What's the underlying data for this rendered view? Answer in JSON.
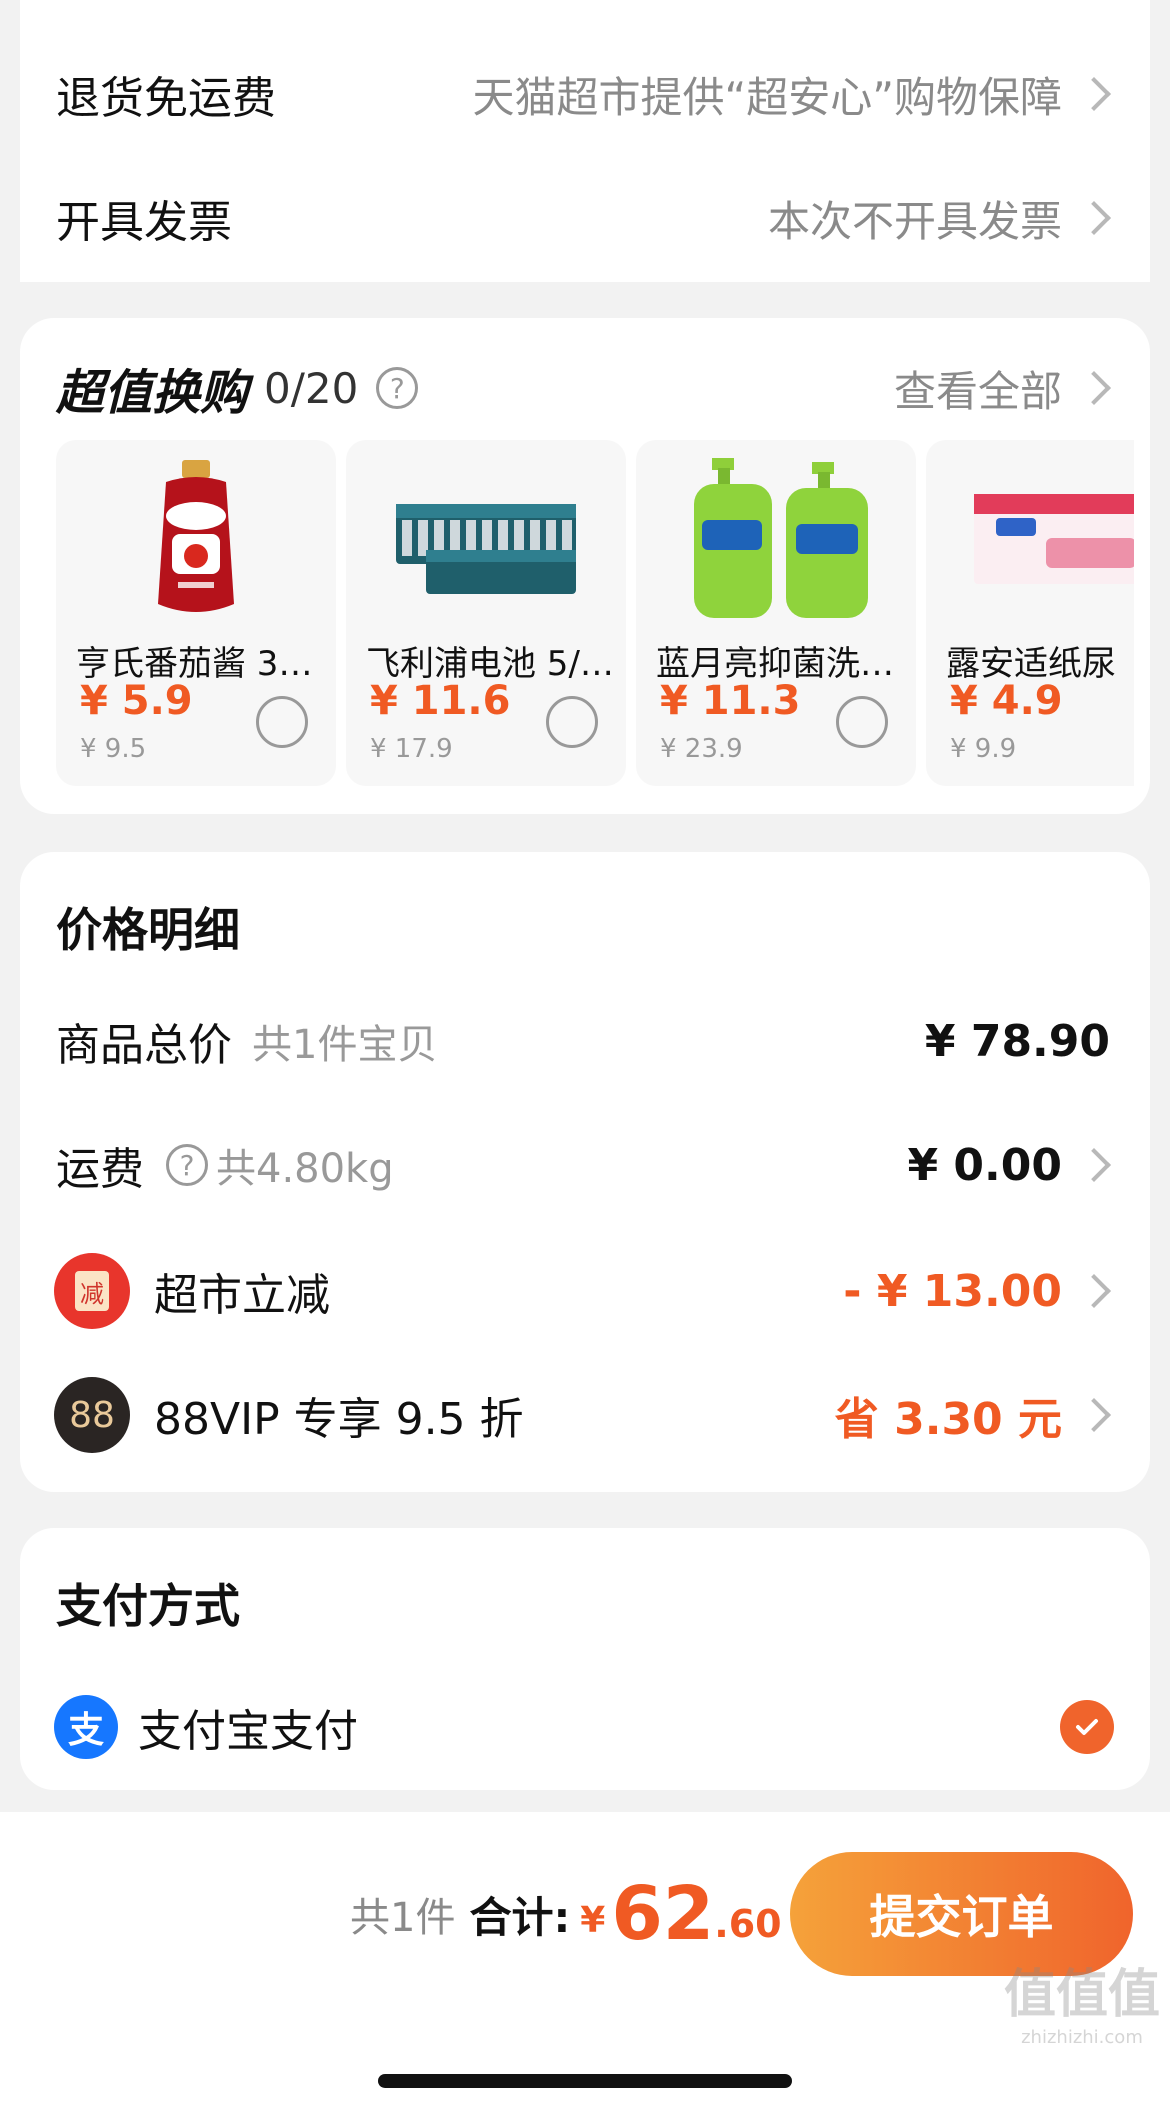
{
  "top_card": {
    "rows": [
      {
        "label": "退货免运费",
        "value": "天猫超市提供“超安心”购物保障"
      },
      {
        "label": "开具发票",
        "value": "本次不开具发票"
      }
    ]
  },
  "exchange": {
    "title": "超值换购",
    "count": "0/20",
    "view_all": "查看全部",
    "products": [
      {
        "name": "亨氏番茄酱 32…",
        "price": "¥ 5.9",
        "orig": "¥ 9.5"
      },
      {
        "name": "飞利浦电池 5/…",
        "price": "¥ 11.6",
        "orig": "¥ 17.9"
      },
      {
        "name": "蓝月亮抑菌洗…",
        "price": "¥ 11.3",
        "orig": "¥ 23.9"
      },
      {
        "name": "露安适纸尿",
        "price": "¥ 4.9",
        "orig": "¥ 9.9"
      }
    ]
  },
  "price_detail": {
    "title": "价格明细",
    "total_label": "商品总价",
    "total_sub": "共1件宝贝",
    "total_value": "¥ 78.90",
    "shipping_label": "运费",
    "shipping_sub": "共4.80kg",
    "shipping_value": "¥ 0.00",
    "discount_icon": "减",
    "discount_label": "超市立减",
    "discount_value": "- ¥ 13.00",
    "vip_icon": "88",
    "vip_label": "88VIP 专享 9.5 折",
    "vip_value": "省 3.30 元"
  },
  "payment": {
    "title": "支付方式",
    "alipay_icon": "支",
    "alipay_label": "支付宝支付"
  },
  "footer": {
    "count": "共1件",
    "total_label": "合计:",
    "currency": "¥",
    "total_int": "62",
    "total_dec": ".60",
    "submit": "提交订单"
  },
  "watermark": {
    "brand": "值值值",
    "domain": "zhizhizhi.com"
  },
  "colors": {
    "accent": "#f05a23",
    "alipay": "#1677ff",
    "discount_red": "#e8352c"
  }
}
